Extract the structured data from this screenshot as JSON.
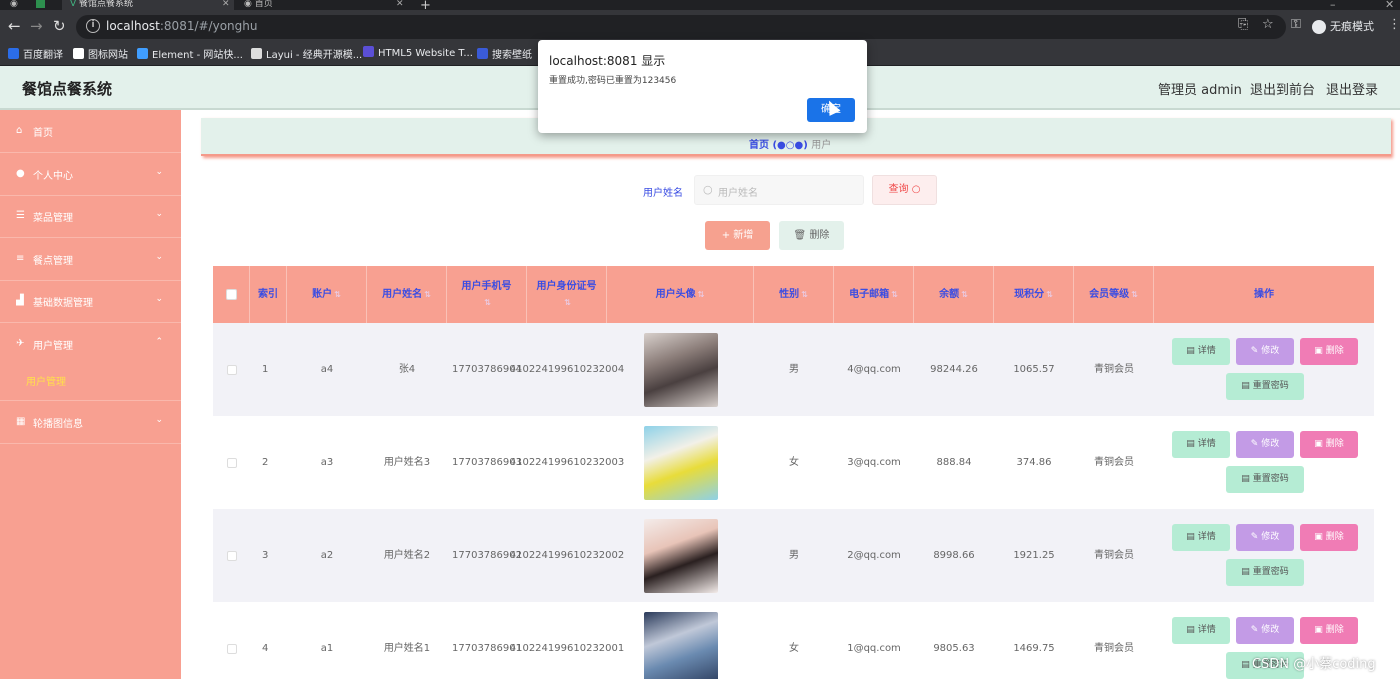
{
  "browser": {
    "tabs": [
      {
        "label": "",
        "active": false
      },
      {
        "label": "",
        "active": false
      },
      {
        "label": "餐馆点餐系统",
        "active": true
      },
      {
        "label": "首页",
        "active": false
      }
    ],
    "url_host": "localhost",
    "url_rest": ":8081/#/yonghu",
    "incognito_label": "无痕模式",
    "bookmarks": [
      "百度翻译",
      "图标网站",
      "Element - 网站快...",
      "Layui - 经典开源模...",
      "HTML5 Website T...",
      "搜索壁纸"
    ]
  },
  "app": {
    "title": "餐馆点餐系统",
    "header_links": [
      "管理员 admin",
      "退出到前台",
      "退出登录"
    ]
  },
  "sidebar": {
    "items": [
      {
        "icon": "home-icon",
        "glyph": "⌂",
        "label": "首页",
        "chevron": ""
      },
      {
        "icon": "user-icon",
        "glyph": "●",
        "label": "个人中心",
        "chevron": "⌄"
      },
      {
        "icon": "list-icon",
        "glyph": "☰",
        "label": "菜品管理",
        "chevron": "⌄"
      },
      {
        "icon": "menu-icon",
        "glyph": "≡",
        "label": "餐点管理",
        "chevron": "⌄"
      },
      {
        "icon": "chart-icon",
        "glyph": "▟",
        "label": "基础数据管理",
        "chevron": "⌄"
      },
      {
        "icon": "send-icon",
        "glyph": "✈",
        "label": "用户管理",
        "chevron": "⌃"
      },
      {
        "icon": "grid-icon",
        "glyph": "▦",
        "label": "轮播图信息",
        "chevron": "⌄"
      }
    ],
    "sub_item": "用户管理"
  },
  "breadcrumb": {
    "home": "首页",
    "current": "用户"
  },
  "search": {
    "label": "用户姓名",
    "placeholder": "用户姓名",
    "button": "查询"
  },
  "actions": {
    "add": "+ 新增",
    "delete": "删除"
  },
  "table": {
    "headers": [
      "索引",
      "账户",
      "用户姓名",
      "用户手机号",
      "用户身份证号",
      "用户头像",
      "性别",
      "电子邮箱",
      "余额",
      "现积分",
      "会员等级",
      "操作"
    ],
    "ops": {
      "detail": "详情",
      "edit": "修改",
      "delete": "删除",
      "reset": "重置密码"
    },
    "rows": [
      {
        "index": "1",
        "account": "a4",
        "name": "张4",
        "phone1": "1770378690",
        "phone2": "4",
        "id1": "4102241996",
        "id2": "10232004",
        "gender": "男",
        "email": "4@qq.com",
        "balance": "98244.26",
        "points": "1065.57",
        "level": "青铜会员",
        "avatar_colors": [
          "#d8d0cc",
          "#4a4040",
          "#8a7c78"
        ]
      },
      {
        "index": "2",
        "account": "a3",
        "name": "用户姓名3",
        "phone1": "1770378690",
        "phone2": "3",
        "id1": "4102241996",
        "id2": "10232003",
        "gender": "女",
        "email": "3@qq.com",
        "balance": "888.84",
        "points": "374.86",
        "level": "青铜会员",
        "avatar_colors": [
          "#8ed1e8",
          "#e8dc3a",
          "#f2f0e8"
        ]
      },
      {
        "index": "3",
        "account": "a2",
        "name": "用户姓名2",
        "phone1": "1770378690",
        "phone2": "2",
        "id1": "4102241996",
        "id2": "10232002",
        "gender": "男",
        "email": "2@qq.com",
        "balance": "8998.66",
        "points": "1921.25",
        "level": "青铜会员",
        "avatar_colors": [
          "#f4ecea",
          "#2a2020",
          "#e8c4b8"
        ]
      },
      {
        "index": "4",
        "account": "a1",
        "name": "用户姓名1",
        "phone1": "1770378690",
        "phone2": "1",
        "id1": "4102241996",
        "id2": "10232001",
        "gender": "女",
        "email": "1@qq.com",
        "balance": "9805.63",
        "points": "1469.75",
        "level": "青铜会员",
        "avatar_colors": [
          "#2a3a5a",
          "#6a8ab0",
          "#c0c8d8"
        ]
      }
    ]
  },
  "dialog": {
    "title": "localhost:8081 显示",
    "message": "重置成功,密码已重置为123456",
    "ok": "确定"
  },
  "watermark": "CSDN @小蔡coding",
  "colors": {
    "sidebar": "#f8a091",
    "header": "#e3f1eb",
    "accent_text": "#3a4de3"
  }
}
